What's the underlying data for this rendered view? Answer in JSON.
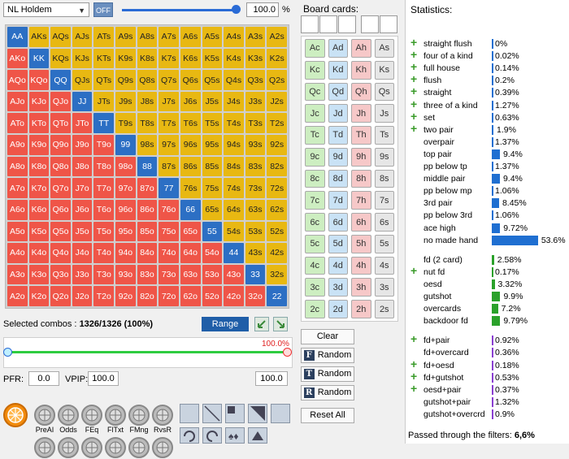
{
  "top": {
    "game": "NL Holdem",
    "off_label": "OFF",
    "pct": "100.0",
    "pct_sign": "%"
  },
  "ranks": [
    "A",
    "K",
    "Q",
    "J",
    "T",
    "9",
    "8",
    "7",
    "6",
    "5",
    "4",
    "3",
    "2"
  ],
  "selected": {
    "label": "Selected combos :",
    "value": "1326/1326 (100%)"
  },
  "range_btn": "Range",
  "range_pct": "100.0%",
  "pfr": {
    "label": "PFR:",
    "value": "0.0"
  },
  "vpip": {
    "label": "VPIP:",
    "value": "100.0"
  },
  "total": "100.0",
  "filters": [
    "PreAI",
    "Odds",
    "FEq",
    "FlTxt",
    "FMng",
    "RvsR"
  ],
  "board": {
    "title": "Board cards:",
    "suits": [
      "c",
      "d",
      "h",
      "s"
    ]
  },
  "buttons": {
    "clear": "Clear",
    "random": "Random",
    "reset": "Reset All"
  },
  "random_icons": [
    "F",
    "T",
    "R"
  ],
  "stats": {
    "title": "Statistics:",
    "group1": [
      {
        "name": "straight flush",
        "pct": "0%",
        "v": 0,
        "plus": true
      },
      {
        "name": "four of a kind",
        "pct": "0.02%",
        "v": 0.02,
        "plus": true
      },
      {
        "name": "full house",
        "pct": "0.14%",
        "v": 0.14,
        "plus": true
      },
      {
        "name": "flush",
        "pct": "0.2%",
        "v": 0.2,
        "plus": true
      },
      {
        "name": "straight",
        "pct": "0.39%",
        "v": 0.39,
        "plus": true
      },
      {
        "name": "three of a kind",
        "pct": "1.27%",
        "v": 1.27,
        "plus": true
      },
      {
        "name": "set",
        "pct": "0.63%",
        "v": 0.63,
        "plus": true
      },
      {
        "name": "two pair",
        "pct": "1.9%",
        "v": 1.9,
        "plus": true
      },
      {
        "name": "overpair",
        "pct": "1.37%",
        "v": 1.37,
        "plus": false
      },
      {
        "name": "top pair",
        "pct": "9.4%",
        "v": 9.4,
        "plus": false
      },
      {
        "name": "pp below tp",
        "pct": "1.37%",
        "v": 1.37,
        "plus": false
      },
      {
        "name": "middle pair",
        "pct": "9.4%",
        "v": 9.4,
        "plus": false
      },
      {
        "name": "pp below mp",
        "pct": "1.06%",
        "v": 1.06,
        "plus": false
      },
      {
        "name": "3rd pair",
        "pct": "8.45%",
        "v": 8.45,
        "plus": false
      },
      {
        "name": "pp below 3rd",
        "pct": "1.06%",
        "v": 1.06,
        "plus": false
      },
      {
        "name": "ace high",
        "pct": "9.72%",
        "v": 9.72,
        "plus": false
      },
      {
        "name": "no made hand",
        "pct": "53.6%",
        "v": 53.6,
        "plus": false
      }
    ],
    "group2": [
      {
        "name": "fd (2 card)",
        "pct": "2.58%",
        "v": 2.58,
        "plus": false
      },
      {
        "name": "nut fd",
        "pct": "0.17%",
        "v": 0.17,
        "plus": true
      },
      {
        "name": "oesd",
        "pct": "3.32%",
        "v": 3.32,
        "plus": false
      },
      {
        "name": "gutshot",
        "pct": "9.9%",
        "v": 9.9,
        "plus": false
      },
      {
        "name": "overcards",
        "pct": "7.2%",
        "v": 7.2,
        "plus": false
      },
      {
        "name": "backdoor fd",
        "pct": "9.79%",
        "v": 9.79,
        "plus": false
      }
    ],
    "group3": [
      {
        "name": "fd+pair",
        "pct": "0.92%",
        "v": 0.92,
        "plus": true
      },
      {
        "name": "fd+overcard",
        "pct": "0.36%",
        "v": 0.36,
        "plus": false
      },
      {
        "name": "fd+oesd",
        "pct": "0.18%",
        "v": 0.18,
        "plus": true
      },
      {
        "name": "fd+gutshot",
        "pct": "0.53%",
        "v": 0.53,
        "plus": true
      },
      {
        "name": "oesd+pair",
        "pct": "0.37%",
        "v": 0.37,
        "plus": true
      },
      {
        "name": "gutshot+pair",
        "pct": "1.32%",
        "v": 1.32,
        "plus": false
      },
      {
        "name": "gutshot+overcrd",
        "pct": "0.9%",
        "v": 0.9,
        "plus": false
      }
    ],
    "footer_label": "Passed through the filters:",
    "footer_value": "6,6%"
  },
  "colors": {
    "pair": "#2c6fc4",
    "suited": "#e8b812",
    "offsuit": "#ef5548",
    "bar1": "#1f6fd1",
    "bar2": "#2aa12a",
    "bar3": "#8a3fd1"
  }
}
